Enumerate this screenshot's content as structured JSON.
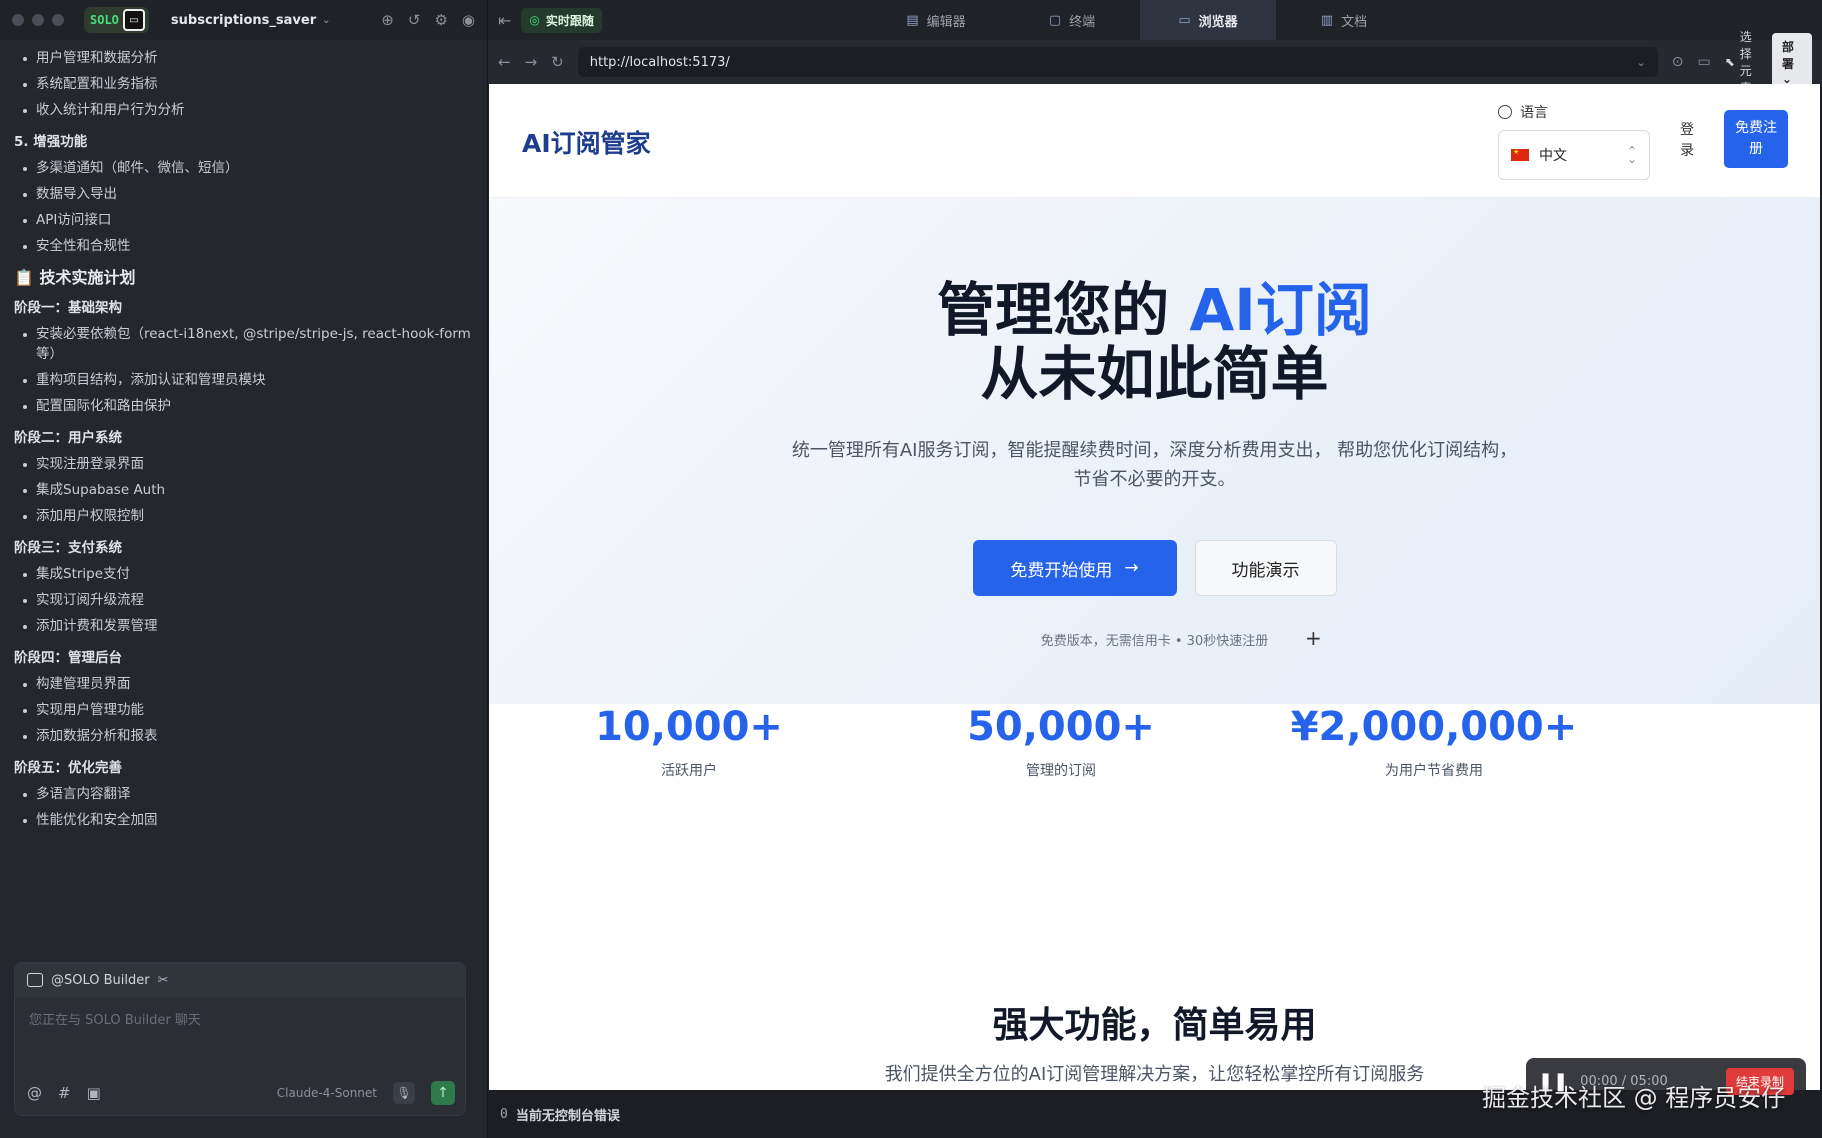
{
  "left": {
    "solo_label": "SOLO",
    "project_name": "subscriptions_saver",
    "chat_lines": [
      {
        "type": "bullet",
        "text": "用户管理和数据分析"
      },
      {
        "type": "bullet",
        "text": "系统配置和业务指标"
      },
      {
        "type": "bullet",
        "text": "收入统计和用户行为分析"
      },
      {
        "type": "heading",
        "text": "5. 增强功能"
      },
      {
        "type": "bullet",
        "text": "多渠道通知（邮件、微信、短信）"
      },
      {
        "type": "bullet",
        "text": "数据导入导出"
      },
      {
        "type": "bullet",
        "text": "API访问接口"
      },
      {
        "type": "bullet",
        "text": "安全性和合规性"
      },
      {
        "type": "big",
        "text": "📋 技术实施计划"
      },
      {
        "type": "heading",
        "text": "阶段一：基础架构"
      },
      {
        "type": "bullet",
        "text": "安装必要依赖包（react-i18next, @stripe/stripe-js, react-hook-form 等）"
      },
      {
        "type": "bullet",
        "text": "重构项目结构，添加认证和管理员模块"
      },
      {
        "type": "bullet",
        "text": "配置国际化和路由保护"
      },
      {
        "type": "heading",
        "text": "阶段二：用户系统"
      },
      {
        "type": "bullet",
        "text": "实现注册登录界面"
      },
      {
        "type": "bullet",
        "text": "集成Supabase Auth"
      },
      {
        "type": "bullet",
        "text": "添加用户权限控制"
      },
      {
        "type": "heading",
        "text": "阶段三：支付系统"
      },
      {
        "type": "bullet",
        "text": "集成Stripe支付"
      },
      {
        "type": "bullet",
        "text": "实现订阅升级流程"
      },
      {
        "type": "bullet",
        "text": "添加计费和发票管理"
      },
      {
        "type": "heading",
        "text": "阶段四：管理后台"
      },
      {
        "type": "bullet",
        "text": "构建管理员界面"
      },
      {
        "type": "bullet",
        "text": "实现用户管理功能"
      },
      {
        "type": "bullet",
        "text": "添加数据分析和报表"
      },
      {
        "type": "heading",
        "text": "阶段五：优化完善"
      },
      {
        "type": "bullet",
        "text": "多语言内容翻译"
      },
      {
        "type": "bullet",
        "text": "性能优化和安全加固"
      }
    ],
    "chat_box": {
      "agent": "@SOLO Builder",
      "placeholder": "您正在与 SOLO Builder 聊天",
      "model": "Claude-4-Sonnet"
    }
  },
  "tabs": {
    "live": "实时跟随",
    "items": [
      {
        "label": "编辑器",
        "icon": "editor-icon",
        "active": false
      },
      {
        "label": "终端",
        "icon": "terminal-icon",
        "active": false
      },
      {
        "label": "浏览器",
        "icon": "browser-icon",
        "active": true
      },
      {
        "label": "文档",
        "icon": "docs-icon",
        "active": false
      }
    ]
  },
  "browser": {
    "url": "http://localhost:5173/",
    "select_element": "选择元素",
    "deploy": "部署"
  },
  "site": {
    "brand": "AI订阅管家",
    "lang_label": "语言",
    "lang_value": "中文",
    "login": "登录",
    "signup": "免费注册",
    "hero_line1_pre": "管理您的 ",
    "hero_line1_accent": "AI订阅",
    "hero_line2": "从未如此简单",
    "hero_sub1": "统一管理所有AI服务订阅，智能提醒续费时间，深度分析费用支出， 帮助您优化订阅结构，",
    "hero_sub2": "节省不必要的开支。",
    "cta_primary": "免费开始使用",
    "cta_secondary": "功能演示",
    "note": "免费版本，无需信用卡 • 30秒快速注册",
    "stats": [
      {
        "num": "10,000+",
        "label": "活跃用户"
      },
      {
        "num": "50,000+",
        "label": "管理的订阅"
      },
      {
        "num": "¥2,000,000+",
        "label": "为用户节省费用"
      }
    ],
    "features_title": "强大功能，简单易用",
    "features_sub": "我们提供全方位的AI订阅管理解决方案，让您轻松掌控所有订阅服务"
  },
  "status": {
    "error_count": "0",
    "text": "当前无控制台错误"
  },
  "recorder": {
    "time": "00:00 / 05:00",
    "stop": "结束录制"
  },
  "watermark": "掘金技术社区 @ 程序员安仔"
}
